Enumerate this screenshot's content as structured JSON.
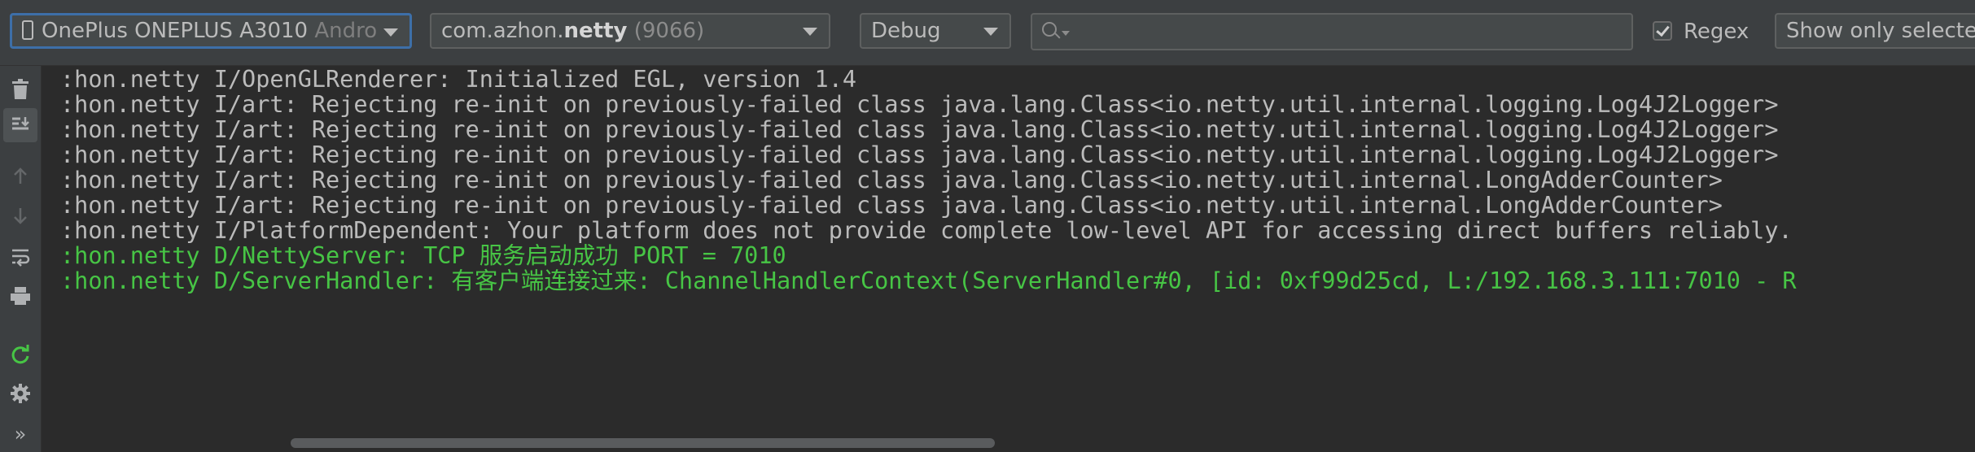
{
  "toolbar": {
    "device": {
      "name": "OnePlus ONEPLUS A3010",
      "suffix": "Andro"
    },
    "process": {
      "prefix": "com.azhon.",
      "bold": "netty",
      "pid": "(9066)"
    },
    "log_level": "Debug",
    "search": {
      "value": "",
      "placeholder": ""
    },
    "regex": {
      "label": "Regex",
      "checked": true
    },
    "filter": "Show only selected"
  },
  "sidebar": {
    "icons": [
      "trash-icon",
      "scroll-to-end-icon",
      "up-arrow-icon",
      "down-arrow-icon",
      "soft-wrap-icon",
      "print-icon",
      "restart-icon",
      "settings-icon",
      "more-icon"
    ],
    "more_label": "»"
  },
  "log": {
    "lines": [
      {
        "level": "I",
        "text": ":hon.netty I/OpenGLRenderer: Initialized EGL, version 1.4"
      },
      {
        "level": "I",
        "text": ":hon.netty I/art: Rejecting re-init on previously-failed class java.lang.Class<io.netty.util.internal.logging.Log4J2Logger>"
      },
      {
        "level": "I",
        "text": ":hon.netty I/art: Rejecting re-init on previously-failed class java.lang.Class<io.netty.util.internal.logging.Log4J2Logger>"
      },
      {
        "level": "I",
        "text": ":hon.netty I/art: Rejecting re-init on previously-failed class java.lang.Class<io.netty.util.internal.logging.Log4J2Logger>"
      },
      {
        "level": "I",
        "text": ":hon.netty I/art: Rejecting re-init on previously-failed class java.lang.Class<io.netty.util.internal.LongAdderCounter>"
      },
      {
        "level": "I",
        "text": ":hon.netty I/art: Rejecting re-init on previously-failed class java.lang.Class<io.netty.util.internal.LongAdderCounter>"
      },
      {
        "level": "I",
        "text": ":hon.netty I/PlatformDependent: Your platform does not provide complete low-level API for accessing direct buffers reliably."
      },
      {
        "level": "D",
        "text": ":hon.netty D/NettyServer: TCP 服务启动成功 PORT = 7010"
      },
      {
        "level": "D",
        "text": ":hon.netty D/ServerHandler: 有客户端连接过来: ChannelHandlerContext(ServerHandler#0, [id: 0xf99d25cd, L:/192.168.3.111:7010 - R"
      }
    ]
  },
  "colors": {
    "info": "#bbbbbb",
    "debug": "#47c545",
    "background": "#2b2b2b",
    "focus": "#3d6fa8"
  }
}
